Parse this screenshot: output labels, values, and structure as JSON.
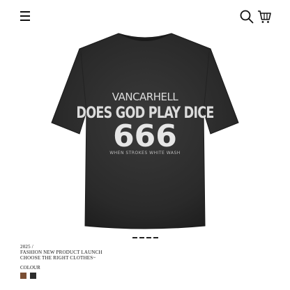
{
  "header": {
    "menu_icon": "hamburger-menu-icon",
    "search_icon": "search-icon",
    "cart_icon": "cart-icon"
  },
  "product": {
    "brand_print": "VANCARHELL",
    "slogan_print": "DOES GOD PLAY DICE",
    "number_print": "666",
    "sub_print": "WHEN STROKES WHITE WASH",
    "shirt_color": "#2b2b2b"
  },
  "pager": {
    "slides": 4
  },
  "info": {
    "year": "2025 /",
    "line1": "FASHION NEW PRODUCT LAUNCH",
    "line2": "CHOOSE THE RIGHT CLOTHES~",
    "colour_label": "COLOUR"
  },
  "colours": [
    {
      "hex": "#7a4e33"
    },
    {
      "hex": "#2d2d2d"
    }
  ]
}
